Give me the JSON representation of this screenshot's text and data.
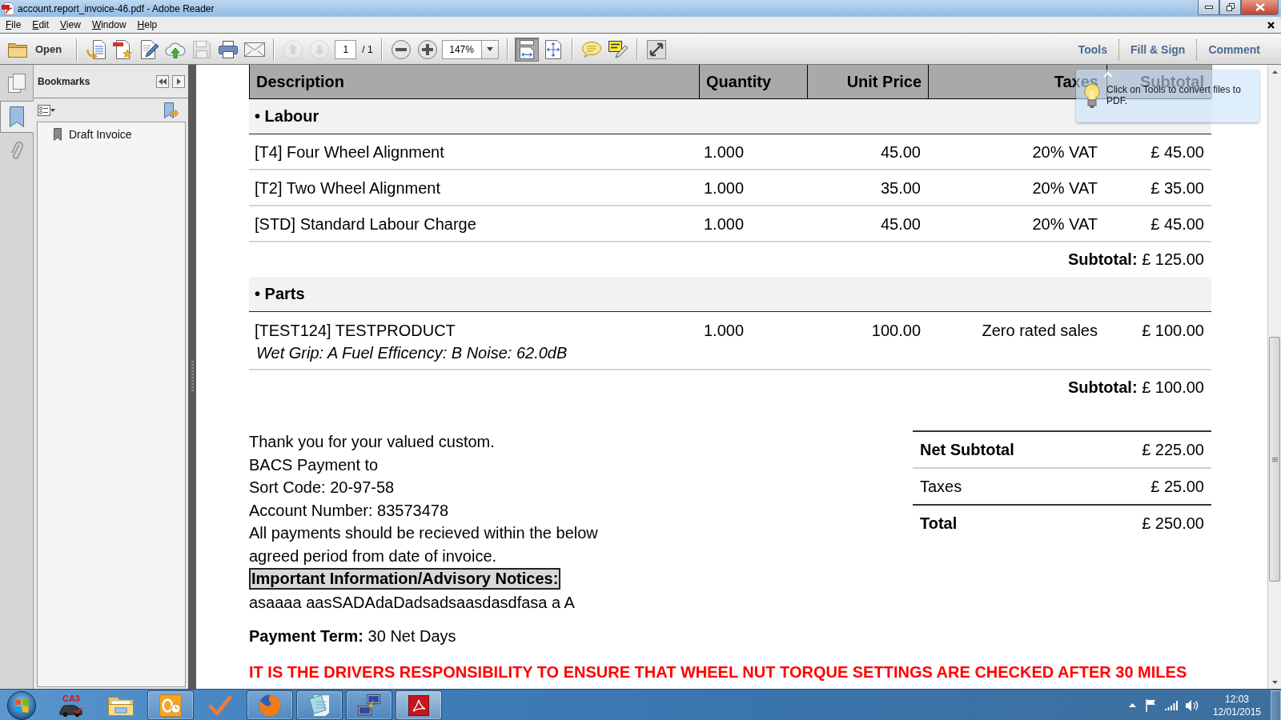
{
  "window": {
    "title": "account.report_invoice-46.pdf - Adobe Reader"
  },
  "menu": [
    "File",
    "Edit",
    "View",
    "Window",
    "Help"
  ],
  "toolbar": {
    "open_label": "Open",
    "tools": [
      {
        "kind": "create-pdf",
        "disabled": false
      },
      {
        "kind": "export-pdf",
        "disabled": false
      },
      {
        "kind": "edit-pdf",
        "disabled": false
      },
      {
        "kind": "upload",
        "disabled": false
      },
      {
        "kind": "save",
        "disabled": true
      },
      {
        "kind": "print",
        "disabled": false
      },
      {
        "kind": "email",
        "disabled": false
      }
    ],
    "page_nav": [
      {
        "kind": "previous",
        "disabled": true
      },
      {
        "kind": "next",
        "disabled": true
      }
    ],
    "page_number": "1",
    "page_count": "/ 1",
    "zoom": "147%",
    "view_modes": [
      {
        "kind": "fit-width",
        "selected": true
      },
      {
        "kind": "fit-page",
        "selected": false
      }
    ],
    "panels": [
      "Tools",
      "Fill & Sign",
      "Comment"
    ]
  },
  "nav_rail": [
    {
      "kind": "pages",
      "selected": false
    },
    {
      "kind": "bookmarks",
      "selected": true
    },
    {
      "kind": "attachments",
      "selected": false
    }
  ],
  "bookmarks": {
    "title": "Bookmarks",
    "items": [
      {
        "label": "Draft Invoice"
      }
    ]
  },
  "invoice": {
    "columns": [
      "Description",
      "Quantity",
      "Unit Price",
      "Taxes",
      "Subtotal"
    ],
    "sections": [
      {
        "title": "• Labour",
        "lines": [
          {
            "description": "[T4] Four Wheel Alignment",
            "quantity": "1.000",
            "unit_price": "45.00",
            "taxes": "20% VAT",
            "subtotal": "£ 45.00"
          },
          {
            "description": "[T2] Two Wheel Alignment",
            "quantity": "1.000",
            "unit_price": "35.00",
            "taxes": "20% VAT",
            "subtotal": "£ 35.00"
          },
          {
            "description": "[STD] Standard Labour Charge",
            "quantity": "1.000",
            "unit_price": "45.00",
            "taxes": "20% VAT",
            "subtotal": "£ 45.00"
          }
        ],
        "subtotal": "**Subtotal:** £ 125.00"
      },
      {
        "title": "• Parts",
        "lines": [
          {
            "description": "[TEST124] TESTPRODUCT",
            "note": "Wet Grip: A Fuel Efficency: B Noise: 62.0dB",
            "quantity": "1.000",
            "unit_price": "100.00",
            "taxes": "Zero rated sales",
            "subtotal": "£ 100.00"
          }
        ],
        "subtotal": "**Subtotal:** £ 100.00"
      }
    ],
    "notes": [
      "Thank you for your valued custom.",
      "BACS Payment to",
      "Sort Code: 20-97-58",
      "Account Number: 83573478",
      "All payments should be recieved within the below agreed period from date of invoice."
    ],
    "totals": [
      {
        "label": "Net Subtotal",
        "value": "£ 225.00",
        "emphasis": true
      },
      {
        "label": "Taxes",
        "value": "£ 25.00",
        "emphasis": false
      },
      {
        "label": "Total",
        "value": "£ 250.00",
        "emphasis": true
      }
    ],
    "notice_heading": "Important Information/Advisory Notices:",
    "notice_text": "asaaaa aasSADAdaDadsadsaasdasdfasa a A",
    "payment_term": "**Payment Term:** 30 Net Days",
    "warning": "IT IS THE DRIVERS RESPONSIBILITY TO ENSURE THAT WHEEL NUT TORQUE SETTINGS ARE CHECKED AFTER 30 MILES"
  },
  "tooltip": {
    "text": "Click on Tools to convert files to PDF."
  },
  "taskbar": {
    "apps": [
      {
        "kind": "car",
        "label": "CA3",
        "running": false,
        "selected": false
      },
      {
        "kind": "folder",
        "running": false,
        "selected": false
      },
      {
        "kind": "mail",
        "running": true,
        "selected": false
      },
      {
        "kind": "check",
        "running": false,
        "selected": false
      },
      {
        "kind": "browser",
        "running": true,
        "selected": false
      },
      {
        "kind": "notepad",
        "running": true,
        "selected": false
      },
      {
        "kind": "network",
        "running": true,
        "selected": false
      },
      {
        "kind": "pdf",
        "running": true,
        "selected": true
      }
    ],
    "clock": {
      "time": "12:03",
      "date": "12/01/2015"
    }
  }
}
